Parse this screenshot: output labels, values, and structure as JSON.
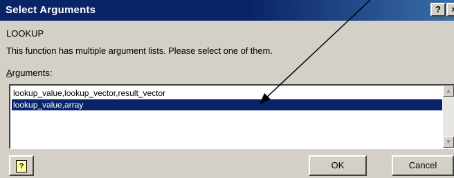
{
  "window": {
    "title": "Select Arguments",
    "help_button": "?",
    "close_button": "×"
  },
  "dialog": {
    "function_name": "LOOKUP",
    "description": "This function has multiple argument lists.  Please select one of them.",
    "arguments_label_access_key": "A",
    "arguments_label_rest": "rguments:"
  },
  "arguments_list": {
    "items": [
      "lookup_value,lookup_vector,result_vector",
      "lookup_value,array"
    ],
    "selected_index": 1
  },
  "buttons": {
    "ok": "OK",
    "cancel": "Cancel",
    "help_icon": "?"
  },
  "icons": {
    "scroll_up": "scroll-up-arrow-icon",
    "scroll_down": "scroll-down-arrow-icon",
    "help": "office-assistant-help-icon"
  },
  "colors": {
    "titlebar": "#0a246a",
    "selection": "#0a246a",
    "dialog_bg": "#d4d0c8"
  }
}
